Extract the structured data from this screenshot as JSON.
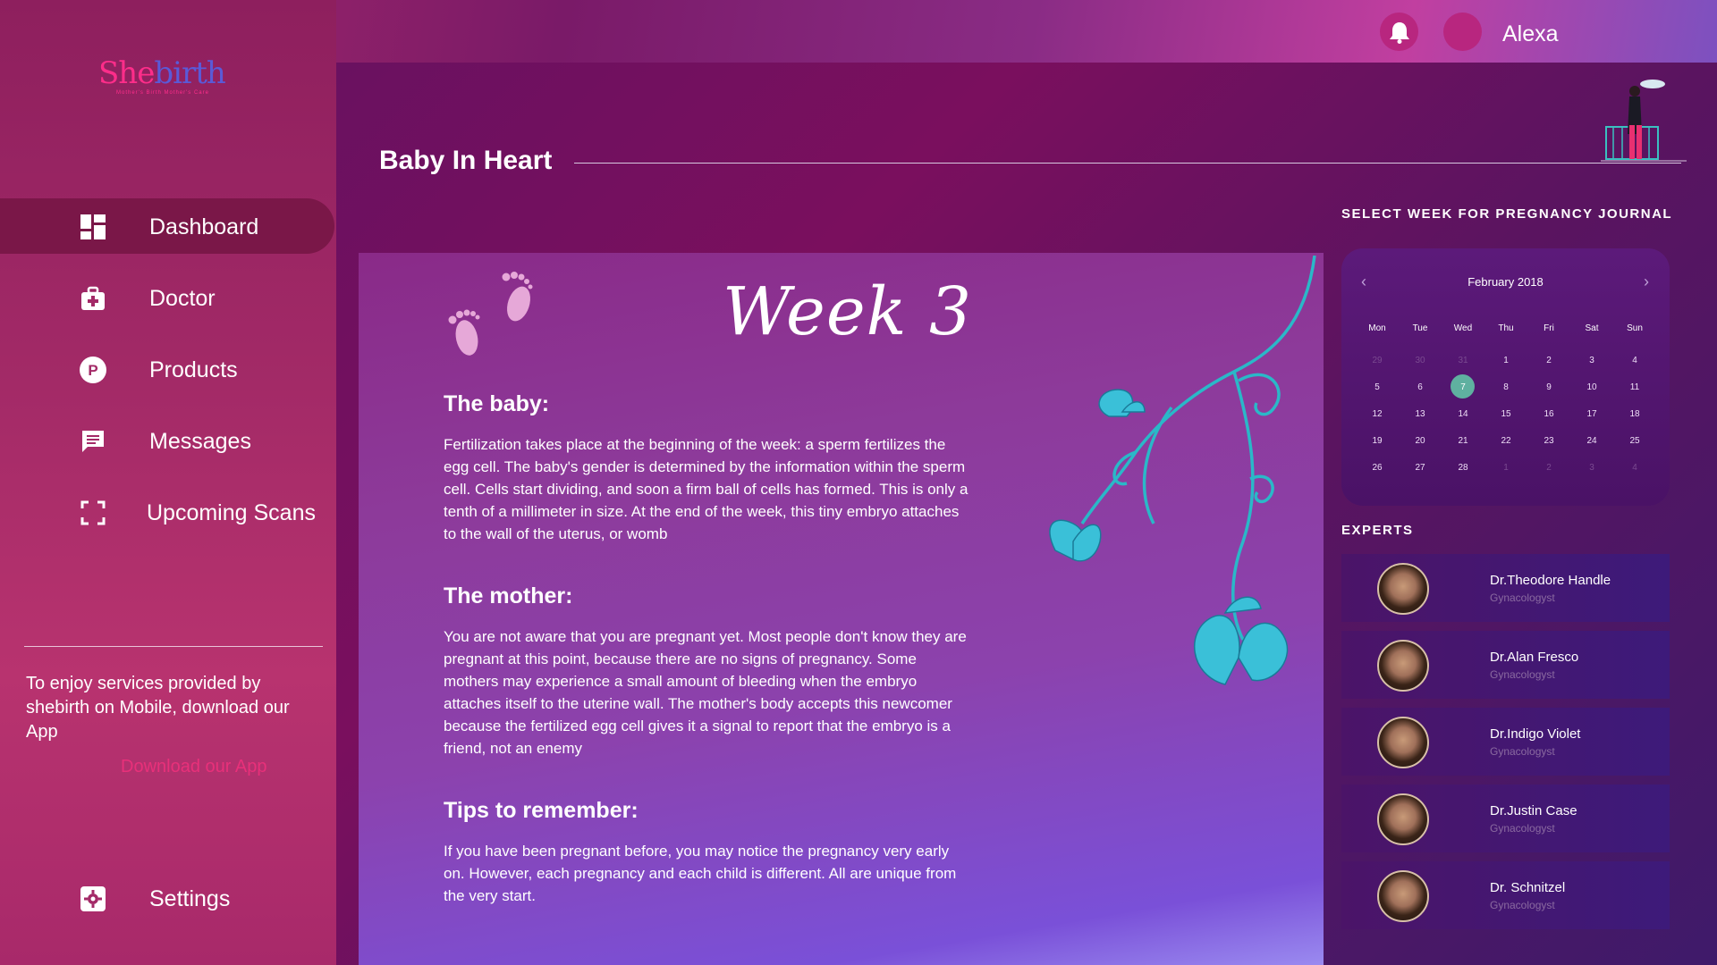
{
  "user": {
    "name": "Alexa"
  },
  "brand": {
    "logo_first": "She",
    "logo_rest": "birth",
    "tagline": "Mother's Birth Mother's Care"
  },
  "sidebar": {
    "items": [
      {
        "label": "Dashboard",
        "icon": "dashboard-icon",
        "active": true
      },
      {
        "label": "Doctor",
        "icon": "medical-kit-icon"
      },
      {
        "label": "Products",
        "icon": "products-icon"
      },
      {
        "label": "Messages",
        "icon": "message-icon"
      },
      {
        "label": "Upcoming Scans",
        "icon": "scan-icon"
      }
    ],
    "promo_text": "To enjoy services provided by shebirth on Mobile, download our App",
    "download_link": "Download our App",
    "settings_label": "Settings"
  },
  "page": {
    "title": "Baby In Heart"
  },
  "content": {
    "week_title": "Week 3",
    "sections": [
      {
        "heading": "The baby:",
        "body": "Fertilization takes place at the beginning of the week: a sperm fertilizes the egg cell. The baby's gender is determined by the information within the sperm cell. Cells start dividing, and soon a firm ball of cells has formed. This is only a tenth of a millimeter in size. At the end of the week, this tiny embryo attaches to the wall of the uterus, or womb"
      },
      {
        "heading": "The mother:",
        "body": "You are not aware that you are pregnant yet. Most people don't know they are pregnant at this point, because there are no signs of pregnancy. Some mothers may experience a small amount of bleeding when the embryo attaches itself to the uterine wall. The mother's body accepts this newcomer because the fertilized egg cell gives it a signal to report that the embryo is a friend, not an enemy"
      },
      {
        "heading": "Tips to remember:",
        "body": "If you have been pregnant before, you may notice the pregnancy very early on. However, each pregnancy and each child is different. All are unique from the very start."
      }
    ]
  },
  "calendar": {
    "label": "SELECT WEEK FOR PREGNANCY JOURNAL",
    "month": "February 2018",
    "days_of_week": [
      "Mon",
      "Tue",
      "Wed",
      "Thu",
      "Fri",
      "Sat",
      "Sun"
    ],
    "weeks": [
      [
        "29",
        "30",
        "31",
        "1",
        "2",
        "3",
        "4"
      ],
      [
        "5",
        "6",
        "7",
        "8",
        "9",
        "10",
        "11"
      ],
      [
        "12",
        "13",
        "14",
        "15",
        "16",
        "17",
        "18"
      ],
      [
        "19",
        "20",
        "21",
        "22",
        "23",
        "24",
        "25"
      ],
      [
        "26",
        "27",
        "28",
        "1",
        "2",
        "3",
        "4"
      ]
    ],
    "selected_day": "7"
  },
  "experts": {
    "label": "EXPERTS",
    "list": [
      {
        "name": "Dr.Theodore Handle",
        "role": "Gynacologyst"
      },
      {
        "name": "Dr.Alan Fresco",
        "role": "Gynacologyst"
      },
      {
        "name": "Dr.Indigo Violet",
        "role": "Gynacologyst"
      },
      {
        "name": "Dr.Justin Case",
        "role": "Gynacologyst"
      },
      {
        "name": "Dr. Schnitzel",
        "role": "Gynacologyst"
      }
    ]
  },
  "colors": {
    "accent_pink": "#e8307a",
    "selected_day": "#5fb0a0",
    "notification": "#b8267f"
  }
}
